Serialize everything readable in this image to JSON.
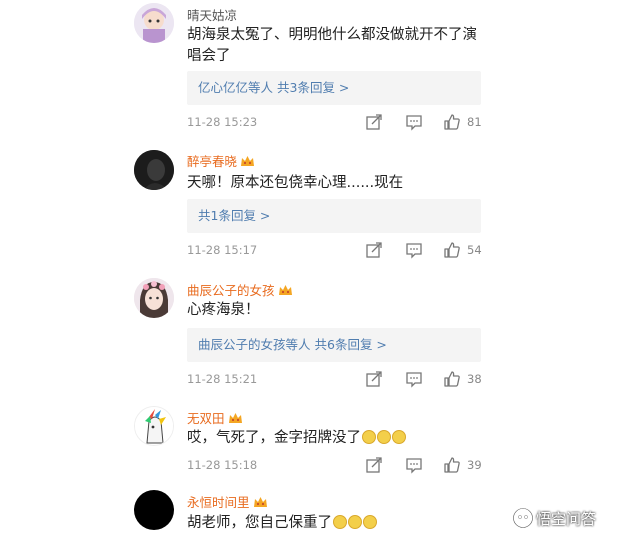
{
  "comments": [
    {
      "user": "晴天姑凉",
      "text": "胡海泉太冤了、明明他什么都没做就开不了演唱会了",
      "reply": {
        "names": "亿心亿亿等人",
        "summary": "共3条回复 >"
      },
      "time": "11-28 15:23",
      "likes": "81"
    },
    {
      "user": "醉亭春晓",
      "text": "天哪！原本还包侥幸心理......现在",
      "reply": {
        "names": "",
        "summary": "共1条回复 >"
      },
      "time": "11-28 15:17",
      "likes": "54"
    },
    {
      "user": "曲辰公子的女孩",
      "text": "心疼海泉！",
      "reply": {
        "names": "曲辰公子的女孩等人",
        "summary": "共6条回复 >"
      },
      "time": "11-28 15:21",
      "likes": "38"
    },
    {
      "user": "无双田",
      "text": "哎，气死了，金字招牌没了",
      "time": "11-28 15:18",
      "likes": "39"
    },
    {
      "user": "永恒时间里",
      "text": "胡老师，您自己保重了"
    }
  ],
  "watermark": "悟空问答",
  "colors": {
    "link": "#507daf",
    "vip_name": "#e86b1f",
    "meta": "#999999",
    "reply_bg": "#f4f4f4"
  }
}
